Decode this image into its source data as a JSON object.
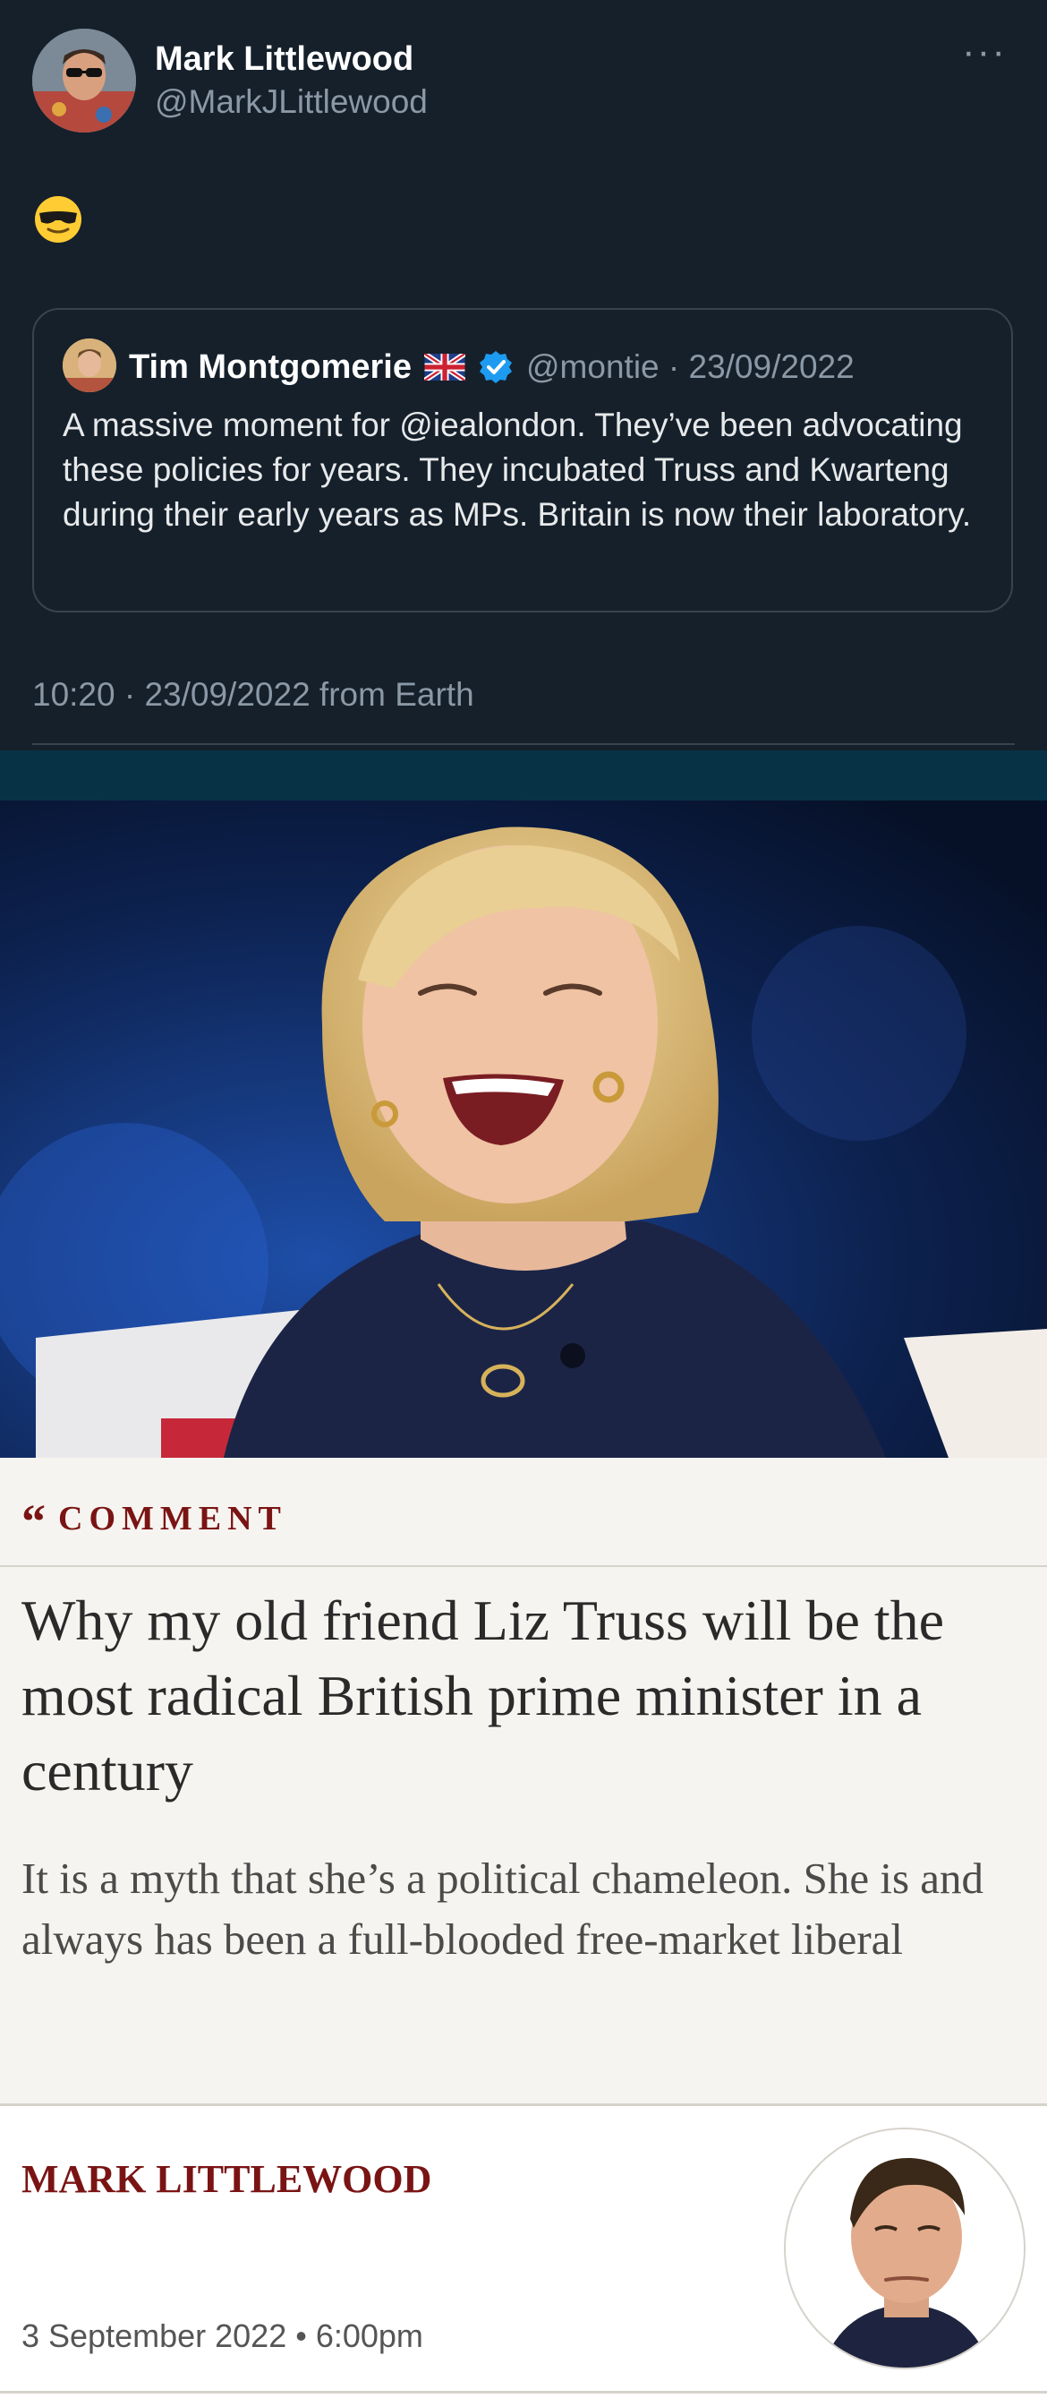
{
  "tweet": {
    "author_name": "Mark Littlewood",
    "author_handle": "@MarkJLittlewood",
    "more_label": "···",
    "body_emoji": "😎",
    "quoted": {
      "name": "Tim Montgomerie",
      "handle_date": "@montie · 23/09/2022",
      "text": "A massive moment for @iealondon. They’ve been advocating these policies for years. They incubated Truss and Kwarteng during their early years as MPs. Britain is now their laboratory."
    },
    "timestamp": "10:20 · 23/09/2022 from Earth"
  },
  "article": {
    "section_mark": "“",
    "section_label": "COMMENT",
    "headline": "Why my old friend Liz Truss will be the most radical British prime minister in a century",
    "standfirst": "It is a myth that she’s a political chameleon. She is and always has been a full-blooded free-market liberal",
    "byline_name": "MARK LITTLEWOOD",
    "byline_date": "3 September 2022 • 6:00pm"
  },
  "colors": {
    "tweet_bg": "#15202b",
    "tweet_text": "#ffffff",
    "tweet_secondary": "#8b98a5",
    "verified_blue": "#1d9bf0",
    "article_bg": "#f6f4f0",
    "telegraph_maroon": "#7a1414"
  },
  "icons": {
    "more": "more-options-icon",
    "verified": "verified-badge-icon",
    "flag": "uk-flag-icon",
    "comment_quote": "quote-mark-icon"
  }
}
